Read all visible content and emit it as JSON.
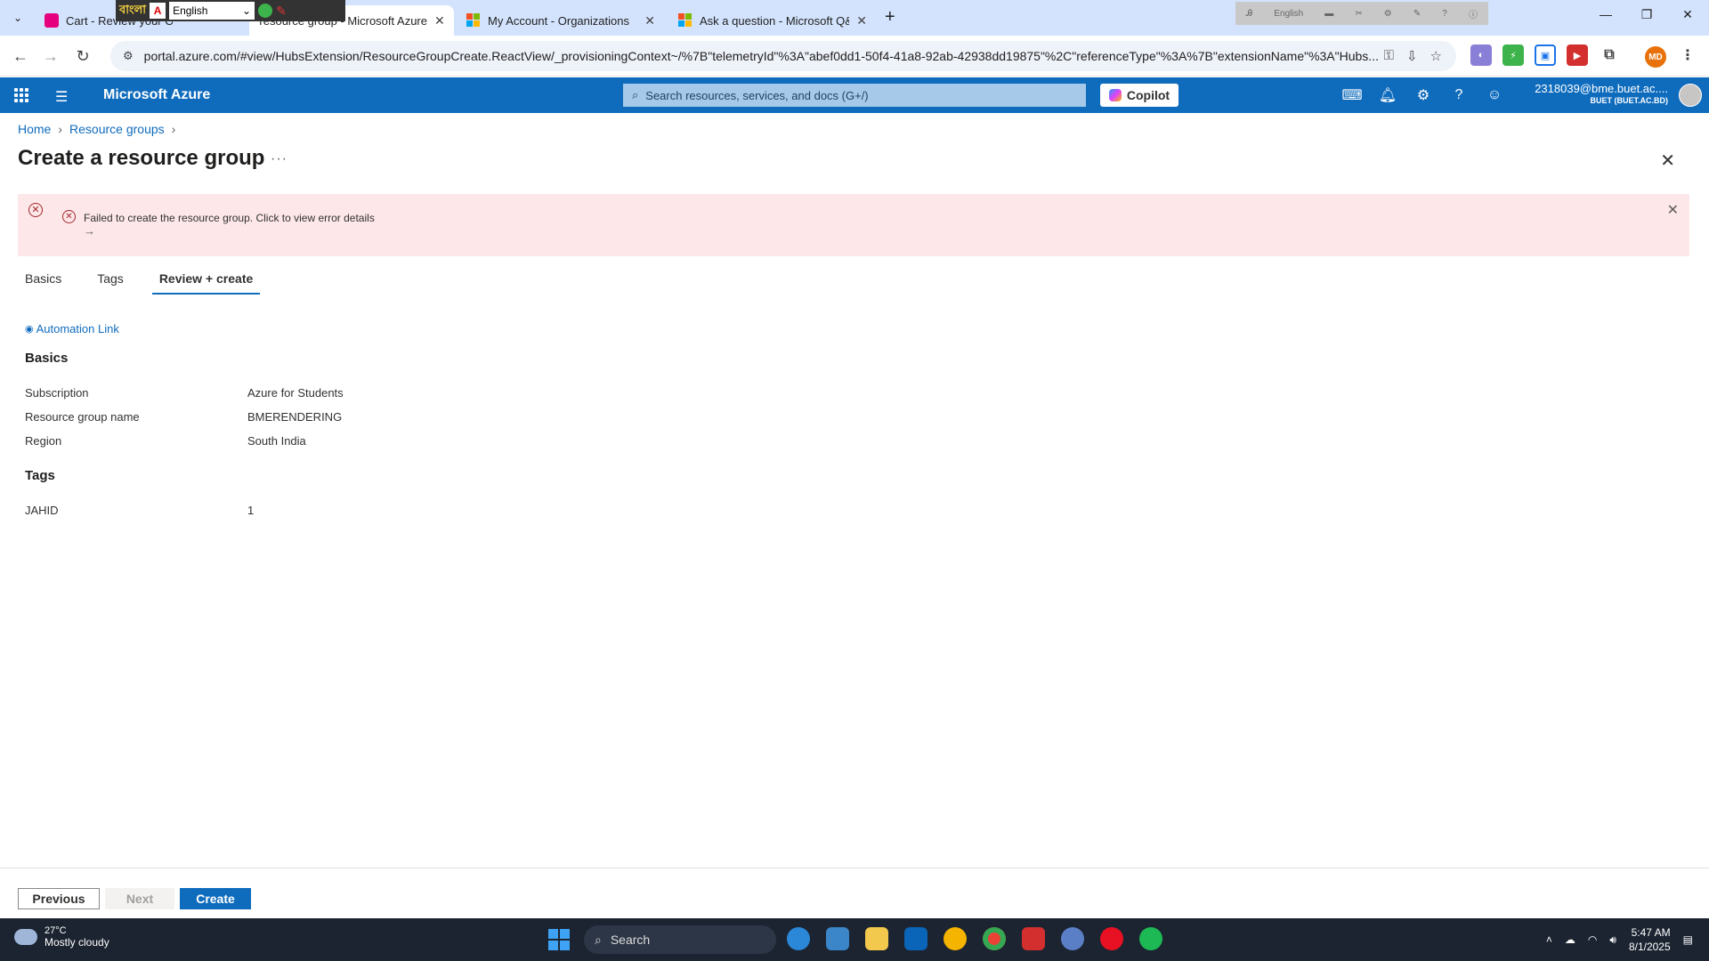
{
  "browser": {
    "tabs": [
      {
        "title": "Cart - Review your Orders",
        "active": false
      },
      {
        "title": "Create a resource group - Microsoft Azure",
        "active": true
      },
      {
        "title": "My Account - Organizations",
        "active": false
      },
      {
        "title": "Ask a question - Microsoft Q&A",
        "active": false
      }
    ],
    "url": "portal.azure.com/#view/HubsExtension/ResourceGroupCreate.ReactView/_provisioningContext~/%7B\"telemetryId\"%3A\"abef0dd1-50f4-41a8-92ab-42938dd19875\"%2C\"referenceType\"%3A%7B\"extensionName\"%3A\"Hubs...",
    "ime_language": "English",
    "ime_script_label": "বাংলা",
    "ime2_language": "English",
    "profile_initials": "MD"
  },
  "azure": {
    "brand": "Microsoft Azure",
    "search_placeholder": "Search resources, services, and docs (G+/)",
    "copilot_label": "Copilot",
    "account_email": "2318039@bme.buet.ac....",
    "account_org": "BUET (BUET.AC.BD)"
  },
  "breadcrumb": [
    "Home",
    "Resource groups"
  ],
  "page": {
    "title": "Create a resource group",
    "more": "···"
  },
  "error": {
    "message": "Failed to create the resource group. Click to view error details",
    "arrow": "→"
  },
  "tabs": [
    "Basics",
    "Tags",
    "Review + create"
  ],
  "selected_tab": "Review + create",
  "automation_link": "Automation Link",
  "basics": {
    "heading": "Basics",
    "rows": [
      {
        "key": "Subscription",
        "value": "Azure for Students"
      },
      {
        "key": "Resource group name",
        "value": "BMERENDERING"
      },
      {
        "key": "Region",
        "value": "South India"
      }
    ]
  },
  "tags": {
    "heading": "Tags",
    "rows": [
      {
        "key": "JAHID",
        "value": "1"
      }
    ]
  },
  "footer": {
    "previous": "Previous",
    "next": "Next",
    "create": "Create"
  },
  "taskbar": {
    "temperature": "27°C",
    "weather": "Mostly cloudy",
    "search_label": "Search",
    "time": "5:47 AM",
    "date": "8/1/2025"
  }
}
